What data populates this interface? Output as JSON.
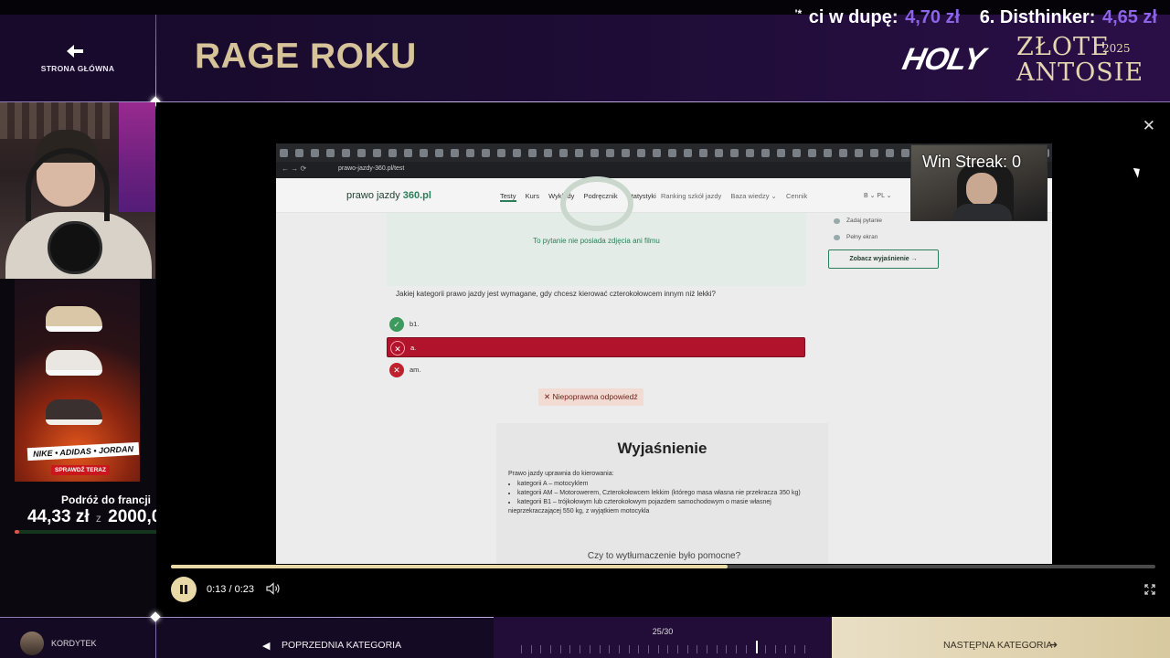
{
  "header": {
    "back_label": "STRONA GŁÓWNA",
    "category_title": "RAGE ROKU",
    "ticker": {
      "item1_label": "ci w dupę:",
      "item1_amount": "4,70 zł",
      "item2_label": "6. Disthinker:",
      "item2_amount": "4,65 zł"
    },
    "brand": {
      "holy": "HOLY",
      "line1": "ZŁOTE",
      "year": "2025",
      "line2": "ANTOSIE"
    }
  },
  "sidebar": {
    "ad": {
      "brands": "NIKE • ADIDAS • JORDAN",
      "cta": "SPRAWDŹ TERAZ"
    },
    "goal": {
      "title": "Podróż do francji",
      "current": "44,33 zł",
      "separator": "z",
      "target": "2000,00 zł",
      "progress_percent": 2.2
    }
  },
  "player": {
    "screen": {
      "url": "prawo-jazdy-360.pl/test",
      "logo_a": "prawo jazdy ",
      "logo_b": "360.pl",
      "menu": [
        "Testy",
        "Kurs",
        "Wykłady",
        "Podręcznik",
        "Statystyki"
      ],
      "menu2": [
        "Ranking szkół jazdy",
        "Baza wiedzy ⌄",
        "Cennik"
      ],
      "lang": "B ⌄     PL ⌄",
      "media_note": "To pytanie nie posiada zdjęcia ani filmu",
      "question": "Jakiej kategorii prawo jazdy jest wymagane, gdy chcesz kierować czterokołowcem innym niż lekki?",
      "answers": [
        {
          "label": "b1.",
          "state": "correct"
        },
        {
          "label": "a.",
          "state": "selected-wrong"
        },
        {
          "label": "am.",
          "state": "wrong"
        }
      ],
      "result": "✕ Niepoprawna odpowiedź",
      "explanation_title": "Wyjaśnienie",
      "explanation_intro": "Prawo jazdy uprawnia do kierowania:",
      "explanation_items": [
        "kategorii A – motocyklem",
        "kategorii AM – Motorowerem, Czterokołowcem lekkim (którego masa własna nie przekracza 350 kg)",
        "kategorii B1 – trójkołowym lub czterokołowym pojazdem samochodowym o masie własnej nieprzekraczającej 550 kg, z wyjątkiem motocykla"
      ],
      "helpful": "Czy to wytłumaczenie było pomocne?",
      "side_items": [
        "Zadaj pytanie",
        "Pełny ekran"
      ],
      "side_button": "Zobacz wyjaśnienie →"
    },
    "overlay_text": "Win Streak: 0",
    "time": "0:13 / 0:23",
    "progress_fraction": 0.565
  },
  "footer": {
    "username": "KORDYTEK",
    "prev_label": "POPRZEDNIA KATEGORIA",
    "counter": "25/30",
    "current_index": 25,
    "total": 30,
    "next_label": "NASTĘPNA KATEGORIA"
  },
  "colors": {
    "accent_gold": "#d6c39a",
    "ticker_purple": "#8d63e8",
    "wrong_red": "#b0132b",
    "correct_green": "#3c9a5e"
  }
}
